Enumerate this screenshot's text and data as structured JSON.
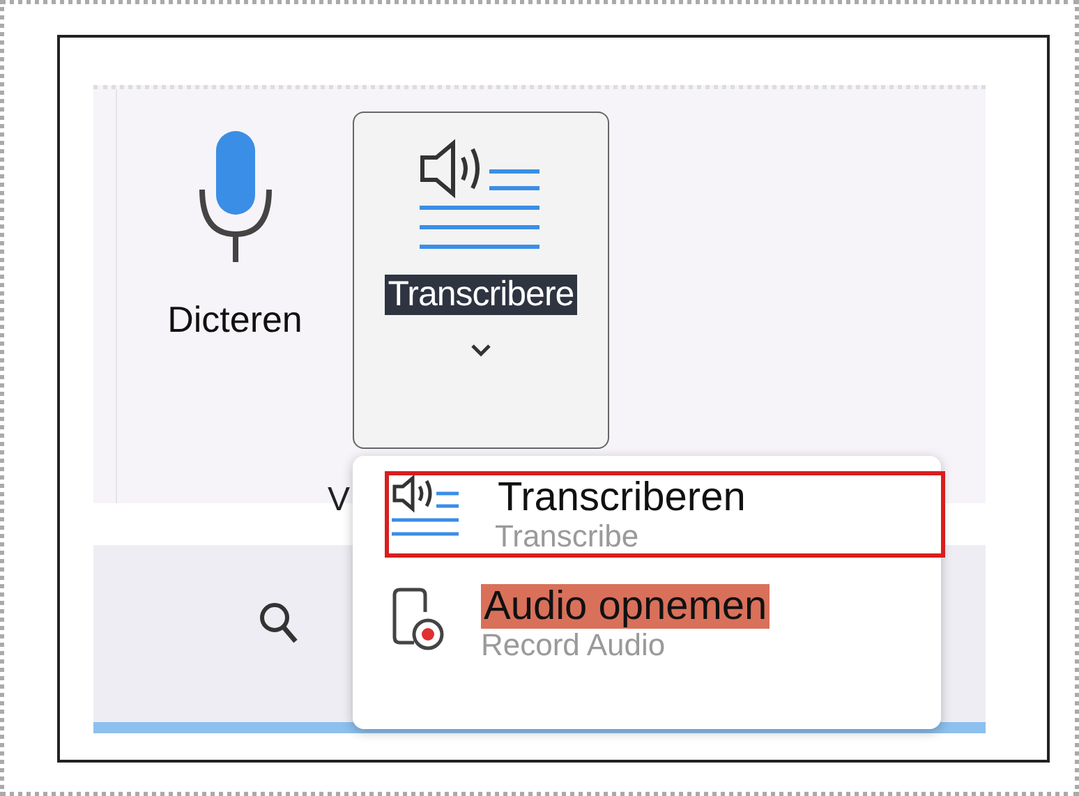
{
  "ribbon": {
    "dictate": {
      "label": "Dicteren"
    },
    "transcribe": {
      "label": "Transcribere",
      "highlighted": true,
      "open": true
    },
    "group_label": "V"
  },
  "menu": {
    "items": [
      {
        "kind": "transcribe",
        "label": "Transcriberen",
        "ghost_label": "Transcribe",
        "highlighted": false,
        "outlined": true
      },
      {
        "kind": "record",
        "label": "Audio opnemen",
        "ghost_label": "Record Audio",
        "highlighted": true,
        "outlined": false
      }
    ]
  }
}
